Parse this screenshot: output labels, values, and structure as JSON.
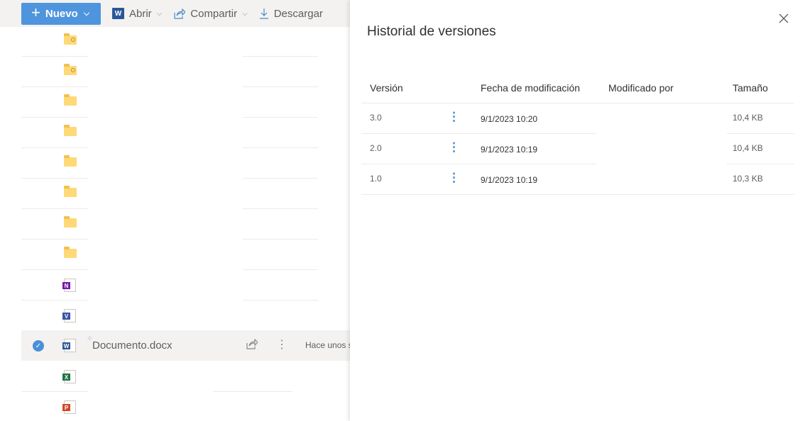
{
  "toolbar": {
    "new_label": "Nuevo",
    "open_label": "Abrir",
    "share_label": "Compartir",
    "download_label": "Descargar"
  },
  "file_list": {
    "selected_file_name": "Documento.docx",
    "selected_file_modified": "Hace unos s",
    "rows": [
      {
        "icon": "shared-folder-icon"
      },
      {
        "icon": "shared-folder-icon"
      },
      {
        "icon": "folder-icon"
      },
      {
        "icon": "folder-icon"
      },
      {
        "icon": "folder-icon"
      },
      {
        "icon": "folder-icon"
      },
      {
        "icon": "folder-icon"
      },
      {
        "icon": "folder-icon"
      },
      {
        "icon": "onenote-icon"
      },
      {
        "icon": "visio-icon"
      },
      {
        "icon": "word-icon"
      },
      {
        "icon": "excel-icon"
      },
      {
        "icon": "powerpoint-icon"
      }
    ]
  },
  "panel": {
    "title": "Historial de versiones",
    "columns": [
      "Versión",
      "Fecha de modificación",
      "Modificado por",
      "Tamaño"
    ],
    "versions": [
      {
        "version": "3.0",
        "date": "9/1/2023 10:20",
        "size": "10,4 KB"
      },
      {
        "version": "2.0",
        "date": "9/1/2023 10:19",
        "size": "10,4 KB"
      },
      {
        "version": "1.0",
        "date": "9/1/2023 10:19",
        "size": "10,3 KB"
      }
    ],
    "more_glyph": "⋮"
  },
  "colors": {
    "accent": "#4f95dd",
    "folder": "#ffd978",
    "word": "#2b5797",
    "excel": "#217346",
    "powerpoint": "#d24726",
    "onenote": "#7719aa",
    "visio": "#3955a3"
  }
}
